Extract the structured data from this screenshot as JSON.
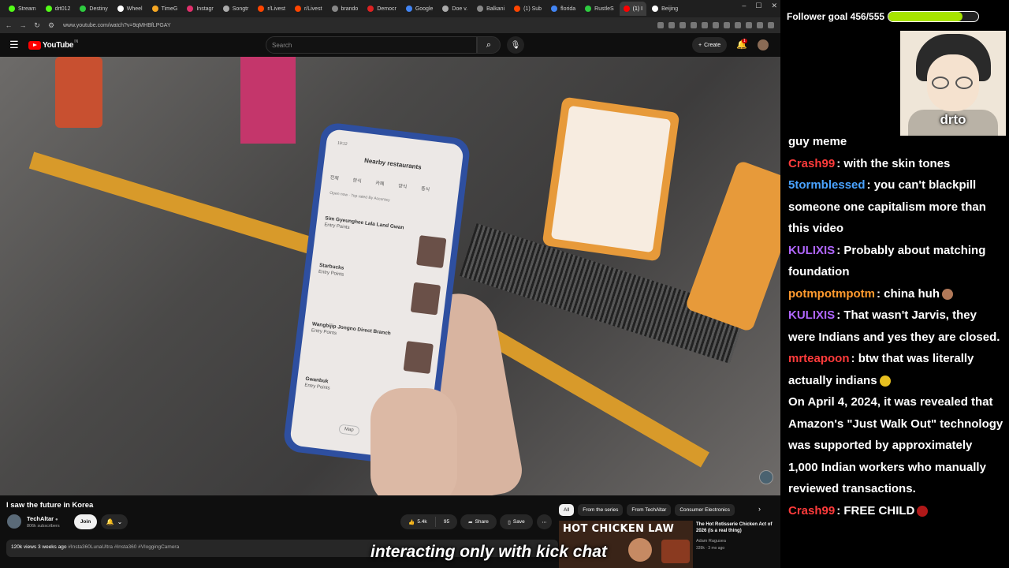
{
  "browser": {
    "tabs": [
      {
        "label": "Stream",
        "color": "#53fc18"
      },
      {
        "label": "drt012",
        "color": "#53fc18"
      },
      {
        "label": "Destiny",
        "color": "#2ecc40"
      },
      {
        "label": "Wheel",
        "color": "#ffffff"
      },
      {
        "label": "TimeG",
        "color": "#f5a623"
      },
      {
        "label": "Instagr",
        "color": "#e1306c"
      },
      {
        "label": "Songtr",
        "color": "#aaaaaa"
      },
      {
        "label": "r/Livest",
        "color": "#ff4500"
      },
      {
        "label": "r/Livest",
        "color": "#ff4500"
      },
      {
        "label": "brando",
        "color": "#888888"
      },
      {
        "label": "Democr",
        "color": "#d22"
      },
      {
        "label": "Google",
        "color": "#4285f4"
      },
      {
        "label": "Doe v.",
        "color": "#aaaaaa"
      },
      {
        "label": "Balkani",
        "color": "#888888"
      },
      {
        "label": "(1) Sub",
        "color": "#ff4500"
      },
      {
        "label": "florida",
        "color": "#4285f4"
      },
      {
        "label": "RustleS",
        "color": "#2ecc40"
      },
      {
        "label": "(1) I",
        "color": "#ff0000",
        "active": true
      },
      {
        "label": "Beijing",
        "color": "#ffffff"
      }
    ],
    "url": "www.youtube.com/watch?v=9qMHBfLPGAY"
  },
  "youtube": {
    "logo": "YouTube",
    "country": "IN",
    "search_placeholder": "Search",
    "create_label": "Create",
    "notif_count": "1"
  },
  "phone_screen": {
    "time": "19:12",
    "title": "Nearby restaurants",
    "tabs": [
      "전체",
      "한식",
      "카페",
      "양식",
      "중식"
    ],
    "filters": "Open now · Top rated   By Accuracy",
    "items": [
      {
        "name": "Sim Gyeunghee Lala Land Gwan",
        "sub": "Entry Points"
      },
      {
        "name": "Starbucks",
        "sub": "Entry Points"
      },
      {
        "name": "Wangbijip Jongno Direct Branch",
        "sub": "Entry Points"
      },
      {
        "name": "Gwanbuk",
        "sub": "Entry Points"
      }
    ],
    "map_label": "Map"
  },
  "video": {
    "title": "I saw the future in Korea",
    "channel": "TechAltar",
    "subscribers": "806k subscribers",
    "join_label": "Join",
    "likes": "5.4k",
    "comments": "95",
    "share_label": "Share",
    "save_label": "Save",
    "meta": "120k views  3 weeks ago",
    "tags": "#Insta360LunaUltra #Insta360 #VloggingCamera"
  },
  "chips": [
    "All",
    "From the series",
    "From TechAltar",
    "Consumer Electronics"
  ],
  "recommendation": {
    "thumb_text": "HOT CHICKEN LAW",
    "title": "The Hot Rotisserie Chicken Act of 2026 (is a real thing)",
    "channel": "Adam Ragusea",
    "meta": "339k · 3 mo ago"
  },
  "caption": "interacting only with kick chat",
  "stream_overlay": {
    "goal_label": "Follower goal 456/555",
    "goal_current": 456,
    "goal_target": 555,
    "goal_color": "#a7e400",
    "webcam_name": "drto"
  },
  "chat": [
    {
      "user": "",
      "color": "#ffffff",
      "text": "guy meme"
    },
    {
      "user": "Crash99",
      "color": "#ff3b3b",
      "text": "with the skin tones"
    },
    {
      "user": "5tormblessed",
      "color": "#4aa3ff",
      "text": "you can't blackpill someone one capitalism more than this video"
    },
    {
      "user": "KULIXIS",
      "color": "#b066ff",
      "text": "Probably about matching foundation"
    },
    {
      "user": "potmpotmpotm",
      "color": "#ff9a2e",
      "text": "china huh"
    },
    {
      "user": "KULIXIS",
      "color": "#b066ff",
      "text": "That wasn't Jarvis, they were Indians and yes they are closed."
    },
    {
      "user": "mrteapoon",
      "color": "#ff3b3b",
      "text": "btw that was literally actually indians"
    },
    {
      "user": "",
      "color": "#ffffff",
      "text": "On April 4, 2024, it was revealed that Amazon's \"Just Walk Out\" technology was supported by approximately 1,000 Indian workers who manually reviewed transactions."
    },
    {
      "user": "Crash99",
      "color": "#ff3b3b",
      "text": "FREE CHILD"
    }
  ]
}
